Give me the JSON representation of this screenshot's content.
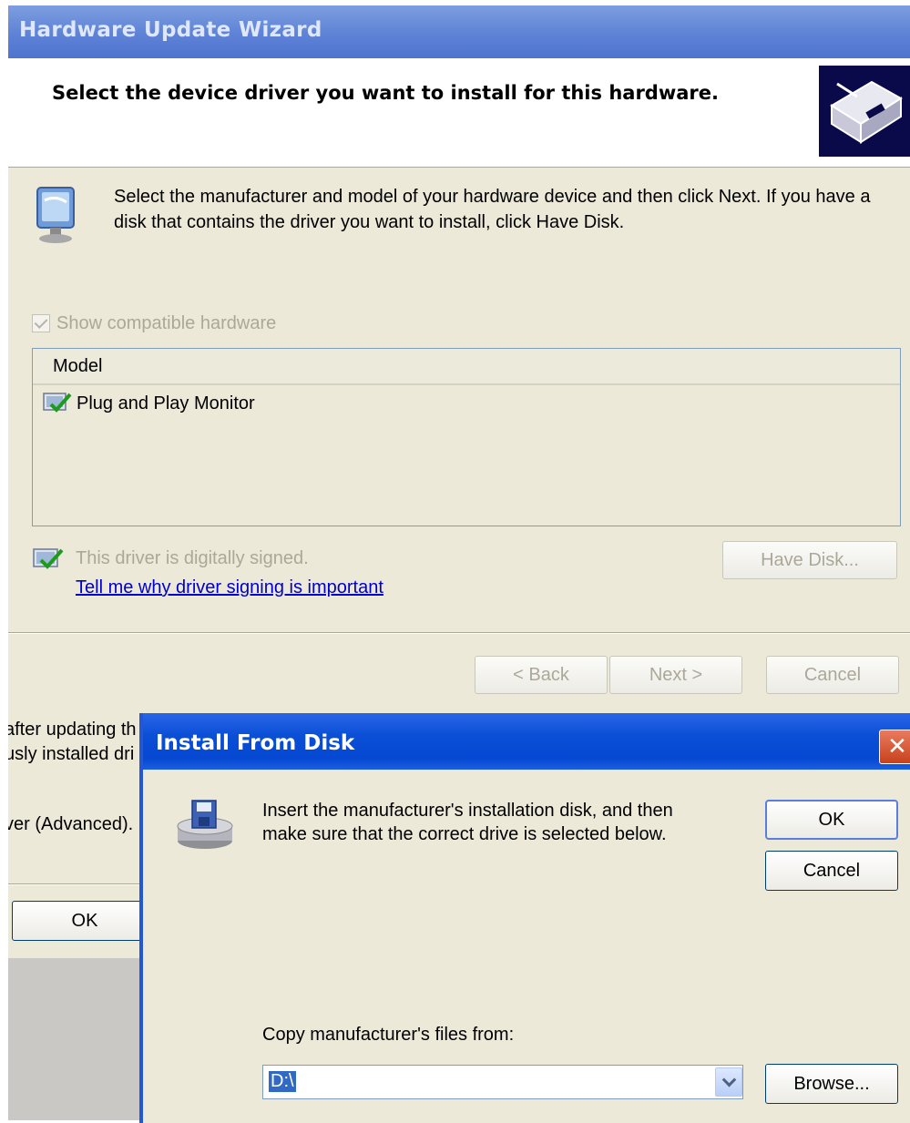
{
  "wizard": {
    "title": "Hardware Update Wizard",
    "heading": "Select the device driver you want to install for this hardware.",
    "description": "Select the manufacturer and model of your hardware device and then click Next. If you have a disk that contains the driver you want to install, click Have Disk.",
    "show_compatible_label": "Show compatible hardware",
    "show_compatible_checked": true,
    "model_list": {
      "column_header": "Model",
      "items": [
        {
          "label": "Plug and Play Monitor",
          "icon": "certified-driver-icon"
        }
      ]
    },
    "signed_text": "This driver is digitally signed.",
    "signing_link": "Tell me why driver signing is important",
    "have_disk_label": "Have Disk...",
    "back_label": "< Back",
    "next_label": "Next >",
    "cancel_label": "Cancel"
  },
  "background_dialog": {
    "line1": "after updating th",
    "line2": "usly installed dri",
    "line3": "ver (Advanced).",
    "ok_label": "OK"
  },
  "install_dialog": {
    "title": "Install From Disk",
    "close_symbol": "✕",
    "message": "Insert the manufacturer's installation disk, and then make sure that the correct drive is selected below.",
    "ok_label": "OK",
    "cancel_label": "Cancel",
    "copy_label": "Copy manufacturer's files from:",
    "path_value": "D:\\",
    "browse_label": "Browse..."
  }
}
